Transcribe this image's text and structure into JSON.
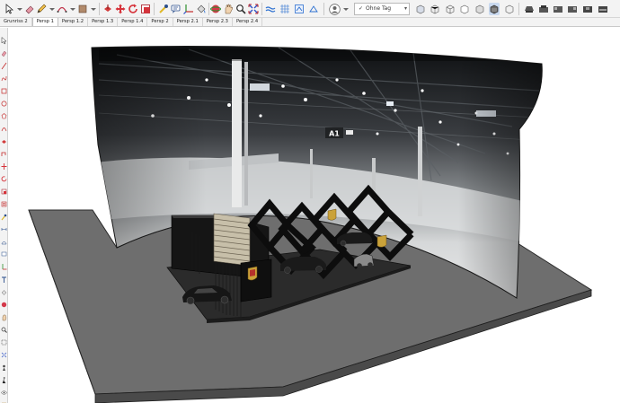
{
  "toolbar": {
    "groups": [
      {
        "name": "edit",
        "icons": [
          "select-arrow-icon",
          "eraser-icon",
          "pencil-line-icon",
          "arc-icon",
          "shape-icon"
        ]
      },
      {
        "name": "modify",
        "icons": [
          "push-pull-icon",
          "move-icon",
          "rotate-icon",
          "scale-icon",
          "offset-icon"
        ]
      },
      {
        "name": "construct",
        "icons": [
          "tape-measure-icon",
          "text-icon",
          "axes-icon",
          "paint-bucket-icon"
        ]
      },
      {
        "name": "camera",
        "icons": [
          "orbit-icon",
          "pan-icon",
          "zoom-icon",
          "zoom-extents-icon"
        ]
      },
      {
        "name": "sandbox",
        "icons": [
          "sandbox-icon",
          "sandbox-smoove-icon",
          "sandbox-stamp-icon"
        ]
      },
      {
        "name": "tags",
        "icons": [
          "user-icon"
        ]
      },
      {
        "name": "styles",
        "icons": [
          "xray-icon",
          "back-edges-icon",
          "wireframe-icon",
          "hidden-line-icon",
          "shaded-icon",
          "shaded-textures-icon",
          "monochrome-icon"
        ]
      },
      {
        "name": "views",
        "icons": [
          "iso-view-icon",
          "top-view-icon",
          "front-view-icon",
          "right-view-icon",
          "back-view-icon",
          "left-view-icon"
        ]
      }
    ],
    "tag_select": {
      "value": "Ohne Tag"
    }
  },
  "scene_tabs": [
    {
      "label": "Grunriss 2",
      "active": false
    },
    {
      "label": "Persp 1",
      "active": true
    },
    {
      "label": "Persp 1.2",
      "active": false
    },
    {
      "label": "Persp 1.3",
      "active": false
    },
    {
      "label": "Persp 1.4",
      "active": false
    },
    {
      "label": "Persp 2",
      "active": false
    },
    {
      "label": "Persp 2.1",
      "active": false
    },
    {
      "label": "Persp 2.3",
      "active": false
    },
    {
      "label": "Persp 2.4",
      "active": false
    }
  ],
  "palette": {
    "icons": [
      "select-icon",
      "eraser-icon",
      "line-icon",
      "freehand-icon",
      "rectangle-icon",
      "circle-icon",
      "polygon-icon",
      "arc-icon",
      "push-pull-icon",
      "follow-me-icon",
      "move-icon",
      "rotate-icon",
      "scale-icon",
      "offset-icon",
      "tape-icon",
      "dimension-icon",
      "protractor-icon",
      "text-icon",
      "axes-icon",
      "3d-text-icon",
      "paint-icon",
      "orbit-icon",
      "pan-icon",
      "zoom-icon",
      "zoom-window-icon",
      "zoom-extents-icon",
      "position-camera-icon",
      "walk-icon",
      "look-around-icon",
      "section-plane-icon"
    ]
  },
  "scene": {
    "hall_sign": "A1",
    "colors": {
      "ground": "#6e6e6e",
      "ground_edge": "#2a2a2a",
      "screen_dark": "#2e3033",
      "screen_light": "#c9ccce",
      "stand_black": "#141414"
    }
  }
}
